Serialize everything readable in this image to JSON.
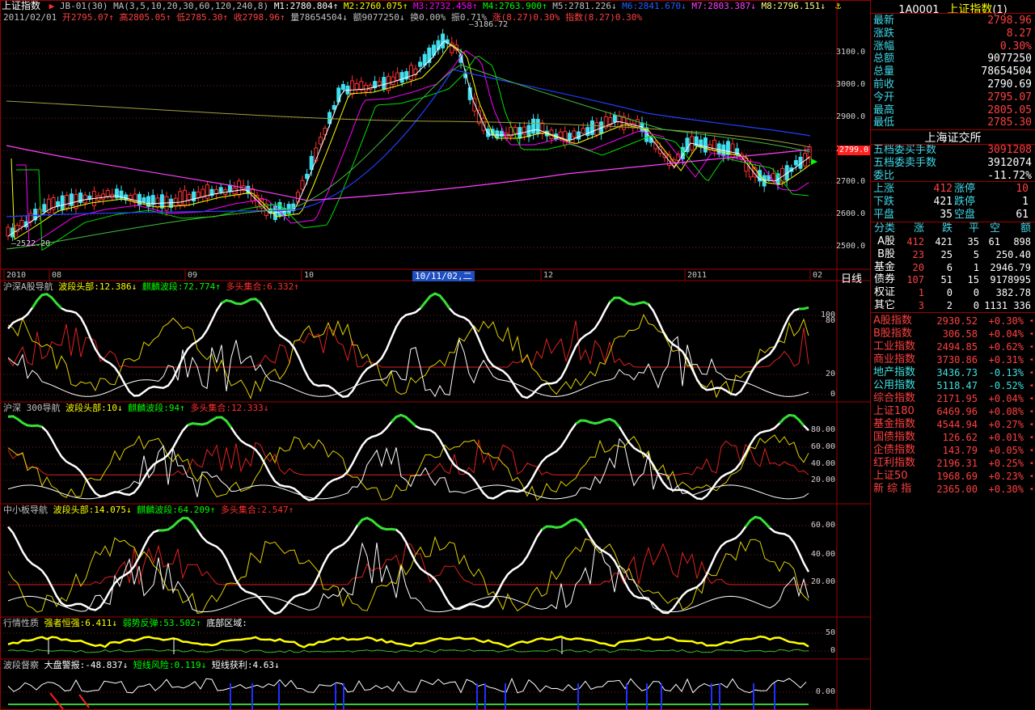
{
  "title_bar": {
    "name": "上证指数",
    "formula": "JB-01(30)",
    "ma_params": "MA(3,5,10,20,30,60,120,240,8)",
    "ma": [
      {
        "label": "M1:2780.804↑",
        "color": "#ffffff"
      },
      {
        "label": "M2:2760.075↑",
        "color": "#ffff00"
      },
      {
        "label": "M3:2732.458↑",
        "color": "#ff00ff"
      },
      {
        "label": "M4:2763.900↑",
        "color": "#00ff00"
      },
      {
        "label": "M5:2781.226↓",
        "color": "#c0c0c0"
      },
      {
        "label": "M6:2841.670↓",
        "color": "#2060ff"
      },
      {
        "label": "M7:2803.387↓",
        "color": "#ff40ff"
      },
      {
        "label": "M8:2796.151↓",
        "color": "#ffff80"
      }
    ]
  },
  "info_line": {
    "date": "2011/02/01",
    "open": "开2795.07↑",
    "high": "高2805.05↑",
    "low": "低2785.30↑",
    "close": "收2798.96↑",
    "volume": "量78654504↓",
    "amount": "额9077250↓",
    "turnover": "换0.00%",
    "amplitude": "振0.71%",
    "change": "涨(8.27)0.30%",
    "index": "指数(8.27)0.30%"
  },
  "price_chart": {
    "y_ticks": [
      "3100.0",
      "3000.0",
      "2900.0",
      "2800.0",
      "2700.0",
      "2600.0",
      "2500.0"
    ],
    "high_label": "3186.72",
    "low_label": "2522.20",
    "current_price": "2799.0",
    "x_labels": [
      "2010",
      "08",
      "09",
      "10",
      "12",
      "2011",
      "02"
    ],
    "cursor_date": "10/11/02,二",
    "period_label": "日线"
  },
  "panels": [
    {
      "title": "沪深A股导航",
      "items": [
        {
          "text": "波段头部:12.386↓",
          "color": "#ffff00"
        },
        {
          "text": "麒麟波段:72.774↑",
          "color": "#00ff00"
        },
        {
          "text": "多头集合:6.332↑",
          "color": "#ff3030"
        }
      ],
      "y_ticks": [
        "100",
        "80",
        "20",
        "0"
      ]
    },
    {
      "title": "沪深 300导航",
      "items": [
        {
          "text": "波段头部:10↓",
          "color": "#ffff00"
        },
        {
          "text": "麒麟波段:94↑",
          "color": "#00ff00"
        },
        {
          "text": "多头集合:12.333↓",
          "color": "#ff3030"
        }
      ],
      "y_ticks": [
        "80.00",
        "60.00",
        "40.00",
        "20.00"
      ]
    },
    {
      "title": "中小板导航",
      "items": [
        {
          "text": "波段头部:14.075↓",
          "color": "#ffff00"
        },
        {
          "text": "麒麟波段:64.209↑",
          "color": "#00ff00"
        },
        {
          "text": "多头集合:2.547↑",
          "color": "#ff3030"
        }
      ],
      "y_ticks": [
        "60.00",
        "40.00",
        "20.00"
      ]
    },
    {
      "title": "行情性质",
      "items": [
        {
          "text": "强者恒强:6.411↓",
          "color": "#ffff00"
        },
        {
          "text": "弱势反弹:53.502↑",
          "color": "#00ff00"
        },
        {
          "text": "底部区域:",
          "color": "#ffffff"
        }
      ],
      "y_ticks": [
        "50",
        "0"
      ]
    },
    {
      "title": "波段督察",
      "items": [
        {
          "text": "大盘警报:-48.837↓",
          "color": "#ffffff"
        },
        {
          "text": "短线风险:0.119↓",
          "color": "#00ff00"
        },
        {
          "text": "短线获利:4.63↓",
          "color": "#ffffff"
        }
      ],
      "y_ticks": [
        "0.00"
      ]
    }
  ],
  "quote": {
    "code": "1A0001",
    "name": "上证指数",
    "suffix": "(1)",
    "rows": [
      {
        "label": "最新",
        "value": "2798.96",
        "color": "#ff4040"
      },
      {
        "label": "涨跌",
        "value": "8.27",
        "color": "#ff4040"
      },
      {
        "label": "涨幅",
        "value": "0.30%",
        "color": "#ff4040"
      },
      {
        "label": "总额",
        "value": "9077250",
        "color": "#ffffff"
      },
      {
        "label": "总量",
        "value": "78654504",
        "color": "#ffffff"
      },
      {
        "label": "前收",
        "value": "2790.69",
        "color": "#ffffff"
      },
      {
        "label": "今开",
        "value": "2795.07",
        "color": "#ff4040"
      },
      {
        "label": "最高",
        "value": "2805.05",
        "color": "#ff4040"
      },
      {
        "label": "最低",
        "value": "2785.30",
        "color": "#ff4040"
      }
    ],
    "exchange": "上海证交所",
    "orders": [
      {
        "label": "五档委买手数",
        "value": "3091208",
        "color": "#ff4040"
      },
      {
        "label": "五档委卖手数",
        "value": "3912074",
        "color": "#ffffff"
      },
      {
        "label": "委比",
        "value": "-11.72%",
        "color": "#ffffff"
      }
    ],
    "breadth": [
      {
        "l1": "上涨",
        "v1": "412",
        "c1": "#ff4040",
        "l2": "涨停",
        "v2": "10",
        "c2": "#ff4040"
      },
      {
        "l1": "下跌",
        "v1": "421",
        "c1": "#ffffff",
        "l2": "跌停",
        "v2": "1",
        "c2": "#ffffff"
      },
      {
        "l1": "平盘",
        "v1": "35",
        "c1": "#ffffff",
        "l2": "空盘",
        "v2": "61",
        "c2": "#ffffff"
      }
    ]
  },
  "category_table": {
    "headers": [
      "分类",
      "涨",
      "跌",
      "平",
      "空",
      "额"
    ],
    "rows": [
      {
        "name": "A股",
        "up": "412",
        "down": "421",
        "flat": "35",
        "empty": "61",
        "amt": "898"
      },
      {
        "name": "B股",
        "up": "23",
        "down": "25",
        "flat": "5",
        "empty": "",
        "amt": "250.40"
      },
      {
        "name": "基金",
        "up": "20",
        "down": "6",
        "flat": "1",
        "empty": "",
        "amt": "2946.79"
      },
      {
        "name": "债券",
        "up": "107",
        "down": "51",
        "flat": "15",
        "empty": "",
        "amt": "9178995"
      },
      {
        "name": "权证",
        "up": "1",
        "down": "0",
        "flat": "0",
        "empty": "",
        "amt": "382.78"
      },
      {
        "name": "其它",
        "up": "3",
        "down": "2",
        "flat": "0",
        "empty": "",
        "amt": "1131 336"
      }
    ]
  },
  "index_list": [
    {
      "name": "A股指数",
      "value": "2930.52",
      "change": "+0.30%",
      "color": "#ff4040"
    },
    {
      "name": "B股指数",
      "value": "306.58",
      "change": "+0.04%",
      "color": "#ff4040"
    },
    {
      "name": "工业指数",
      "value": "2494.85",
      "change": "+0.62%",
      "color": "#ff4040"
    },
    {
      "name": "商业指数",
      "value": "3730.86",
      "change": "+0.31%",
      "color": "#ff4040"
    },
    {
      "name": "地产指数",
      "value": "3436.73",
      "change": "-0.13%",
      "color": "#40e0e0"
    },
    {
      "name": "公用指数",
      "value": "5118.47",
      "change": "-0.52%",
      "color": "#40e0e0"
    },
    {
      "name": "综合指数",
      "value": "2171.95",
      "change": "+0.04%",
      "color": "#ff4040"
    },
    {
      "name": "上证180",
      "value": "6469.96",
      "change": "+0.08%",
      "color": "#ff4040"
    },
    {
      "name": "基金指数",
      "value": "4544.94",
      "change": "+0.27%",
      "color": "#ff4040"
    },
    {
      "name": "国债指数",
      "value": "126.62",
      "change": "+0.01%",
      "color": "#ff4040"
    },
    {
      "name": "企债指数",
      "value": "143.79",
      "change": "+0.05%",
      "color": "#ff4040"
    },
    {
      "name": "红利指数",
      "value": "2196.31",
      "change": "+0.25%",
      "color": "#ff4040"
    },
    {
      "name": "上证50",
      "value": "1968.69",
      "change": "+0.23%",
      "color": "#ff4040"
    },
    {
      "name": "新 综 指",
      "value": "2365.00",
      "change": "+0.30%",
      "color": "#ff4040"
    }
  ]
}
